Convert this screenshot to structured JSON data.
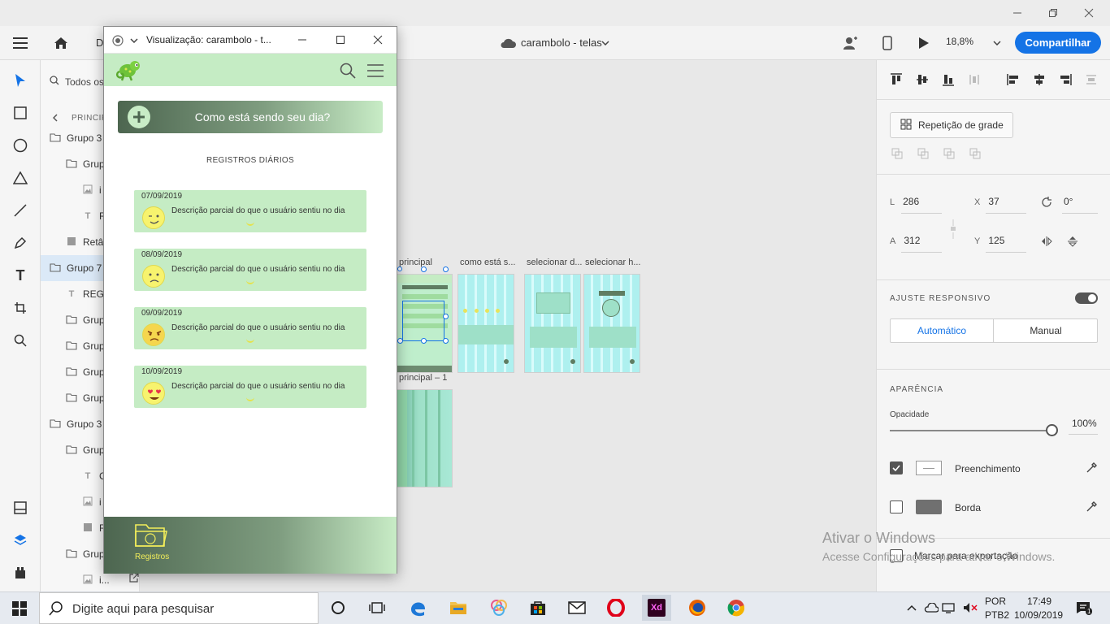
{
  "window": {
    "title": "carambolo - telas",
    "zoom": "18,8%",
    "share_label": "Compartilhar",
    "tab_partial": "D"
  },
  "layers": {
    "search_placeholder": "Todos os",
    "breadcrumb": "PRINCIP",
    "items": [
      {
        "label": "Grupo 3",
        "kind": "folder"
      },
      {
        "label": "Grup",
        "kind": "folder"
      },
      {
        "label": "i",
        "kind": "image"
      },
      {
        "label": "R",
        "kind": "text"
      },
      {
        "label": "Retâ",
        "kind": "rect"
      },
      {
        "label": "Grupo 7",
        "kind": "folder"
      },
      {
        "label": "REGI",
        "kind": "text"
      },
      {
        "label": "Grup",
        "kind": "folder"
      },
      {
        "label": "Grup",
        "kind": "folder"
      },
      {
        "label": "Grup",
        "kind": "folder"
      },
      {
        "label": "Grup",
        "kind": "folder"
      },
      {
        "label": "Grupo 3",
        "kind": "folder"
      },
      {
        "label": "Grup",
        "kind": "folder"
      },
      {
        "label": "C",
        "kind": "text"
      },
      {
        "label": "i",
        "kind": "image"
      },
      {
        "label": "R",
        "kind": "rect"
      },
      {
        "label": "Grup",
        "kind": "folder"
      },
      {
        "label": "i...",
        "kind": "image"
      }
    ]
  },
  "artboards": [
    {
      "label": "principal"
    },
    {
      "label": "como está s..."
    },
    {
      "label": "selecionar d..."
    },
    {
      "label": "selecionar h..."
    },
    {
      "label": "principal – 1"
    }
  ],
  "preview": {
    "title": "Visualização: carambolo - t...",
    "banner_text": "Como está sendo seu dia?",
    "section_title": "REGISTROS DIÁRIOS",
    "entries": [
      {
        "date": "07/09/2019",
        "description": "Descrição parcial do que o usuário sentiu no dia",
        "mood": "wink"
      },
      {
        "date": "08/09/2019",
        "description": "Descrição parcial do que o usuário sentiu no dia",
        "mood": "sad"
      },
      {
        "date": "09/09/2019",
        "description": "Descrição parcial do que o usuário sentiu no dia",
        "mood": "angry"
      },
      {
        "date": "10/09/2019",
        "description": "Descrição parcial do que o usuário sentiu no dia",
        "mood": "love"
      }
    ],
    "footer_label": "Registros"
  },
  "inspector": {
    "repeat_grid": "Repetição de grade",
    "l_label": "L",
    "l_value": "286",
    "x_label": "X",
    "x_value": "37",
    "rotation": "0°",
    "a_label": "A",
    "a_value": "312",
    "y_label": "Y",
    "y_value": "125",
    "responsive_title": "AJUSTE RESPONSIVO",
    "auto_label": "Automático",
    "manual_label": "Manual",
    "appearance_title": "APARÊNCIA",
    "opacity_label": "Opacidade",
    "opacity_value": "100%",
    "fill_label": "Preenchimento",
    "border_label": "Borda",
    "export_label": "Marcar para exportação"
  },
  "watermark": {
    "line1": "Ativar o Windows",
    "line2": "Acesse Configurações para ativar o Windows."
  },
  "taskbar": {
    "search_placeholder": "Digite aqui para pesquisar",
    "lang1": "POR",
    "lang2": "PTB2",
    "time": "17:49",
    "date": "10/09/2019"
  },
  "colors": {
    "accent": "#1473e6",
    "app_green": "#c5ecc4",
    "dark_green": "#4d6650",
    "artboard_cyan": "#aef0ef"
  }
}
